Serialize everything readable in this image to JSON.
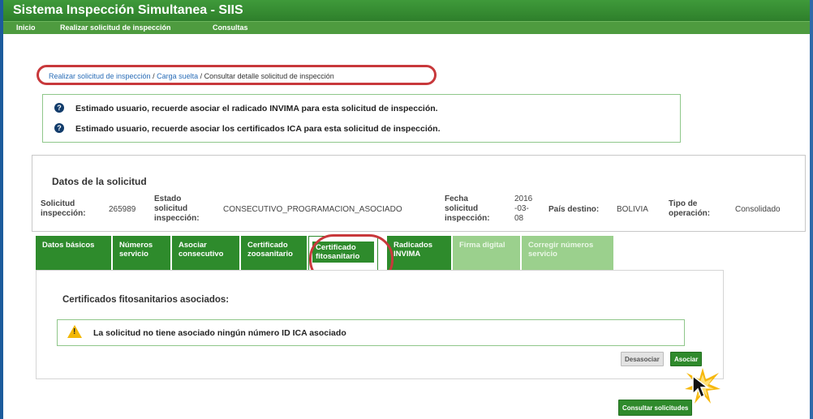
{
  "app": {
    "title": "Sistema Inspección Simultanea - SIIS"
  },
  "menu": {
    "items": [
      {
        "label": "Inicio"
      },
      {
        "label": "Realizar solicitud de inspección"
      },
      {
        "label": "Consultas"
      }
    ]
  },
  "breadcrumb": {
    "part1": "Realizar solicitud de inspección",
    "sep1": " / ",
    "part2": "Carga suelta",
    "sep2": " / ",
    "current": "Consultar detalle solicitud de inspección"
  },
  "notices": [
    {
      "icon": "info-icon",
      "text": "Estimado usuario, recuerde asociar el radicado INVIMA para esta solicitud de inspección."
    },
    {
      "icon": "info-icon",
      "text": "Estimado usuario, recuerde asociar los certificados ICA para esta solicitud de inspección."
    }
  ],
  "datos": {
    "title": "Datos de la solicitud",
    "solicitud_label": "Solicitud\ninspección:",
    "solicitud_value": "265989",
    "estado_label": "Estado\nsolicitud\ninspección:",
    "estado_value": "CONSECUTIVO_PROGRAMACION_ASOCIADO",
    "fecha_label": "Fecha\nsolicitud\ninspección:",
    "fecha_value": "2016\n-03-\n08",
    "pais_label": "País destino:",
    "pais_value": "BOLIVIA",
    "tipo_label": "Tipo de\noperación:",
    "tipo_value": "Consolidado"
  },
  "tabs": [
    {
      "label": "Datos básicos"
    },
    {
      "label": "Números\nservicio"
    },
    {
      "label": "Asociar\nconsecutivo"
    },
    {
      "label": "Certificado\nzoosanitario"
    },
    {
      "label": "Certificado\nfitosanitario"
    },
    {
      "label": "Radicados\nINVIMA"
    },
    {
      "label": "Firma digital"
    },
    {
      "label": "Corregir números\nservicio"
    }
  ],
  "panel": {
    "title": "Certificados fitosanitarios asociados:",
    "warning": "La solicitud no tiene asociado ningún número ID ICA asociado",
    "desasociar": "Desasociar",
    "asociar": "Asociar"
  },
  "footer": {
    "consultar": "Consultar solicitudes"
  },
  "colors": {
    "brand_green": "#2e8b2c",
    "highlight_red": "#c8383b",
    "disabled_green": "#9bd08d"
  }
}
